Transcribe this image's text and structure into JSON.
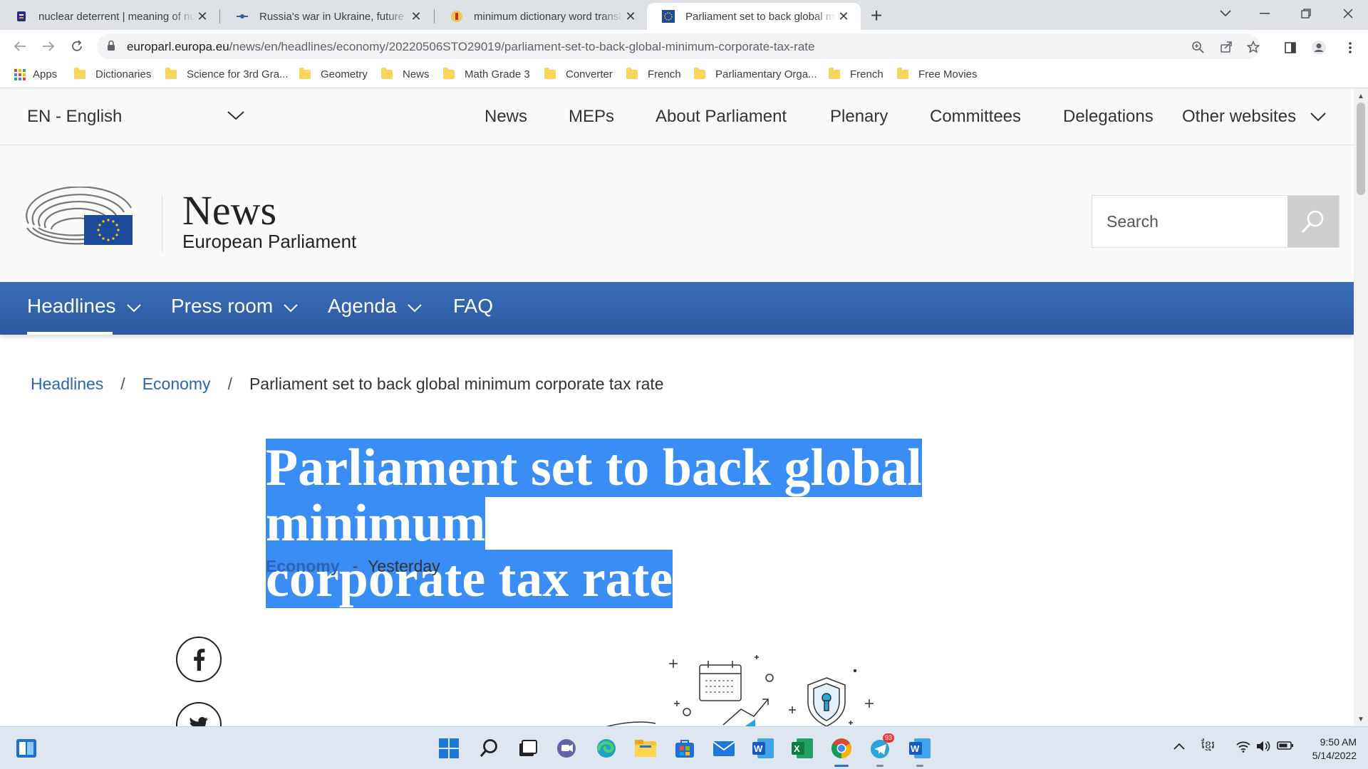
{
  "browser": {
    "tabs": [
      {
        "title": "nuclear deterrent | meaning of nuclear deterrent"
      },
      {
        "title": "Russia's war in Ukraine, future defence"
      },
      {
        "title": "minimum dictionary word translation"
      },
      {
        "title": "Parliament set to back global minimum corporate tax rate"
      }
    ],
    "url_host": "europarl.europa.eu",
    "url_path": "/news/en/headlines/economy/20220506STO29019/parliament-set-to-back-global-minimum-corporate-tax-rate",
    "bookmarks": [
      "Apps",
      "Dictionaries",
      "Science for 3rd Gra...",
      "Geometry",
      "News",
      "Math Grade 3",
      "Converter",
      "French",
      "Parliamentary Orga...",
      "French",
      "Free Movies"
    ]
  },
  "topnav": {
    "language": "EN - English",
    "items": [
      "News",
      "MEPs",
      "About Parliament",
      "Plenary",
      "Committees",
      "Delegations",
      "Other websites"
    ]
  },
  "header": {
    "title": "News",
    "subtitle": "European Parliament",
    "search_placeholder": "Search"
  },
  "mainnav": {
    "items": [
      "Headlines",
      "Press room",
      "Agenda",
      "FAQ"
    ]
  },
  "breadcrumb": {
    "items": [
      "Headlines",
      "Economy"
    ],
    "current": "Parliament set to back global minimum corporate tax rate"
  },
  "article": {
    "title_line1": "Parliament set to back global minimum",
    "title_line2": "corporate tax rate",
    "category": "Economy",
    "separator": "-",
    "date": "Yesterday"
  },
  "taskbar": {
    "telegram_badge": "93",
    "lang": "ខ្មែរ",
    "time": "9:50 AM",
    "date": "5/14/2022"
  },
  "colors": {
    "eu_blue": "#2c5aa0",
    "link": "#2e64b3",
    "selection": "#3a8df5"
  }
}
